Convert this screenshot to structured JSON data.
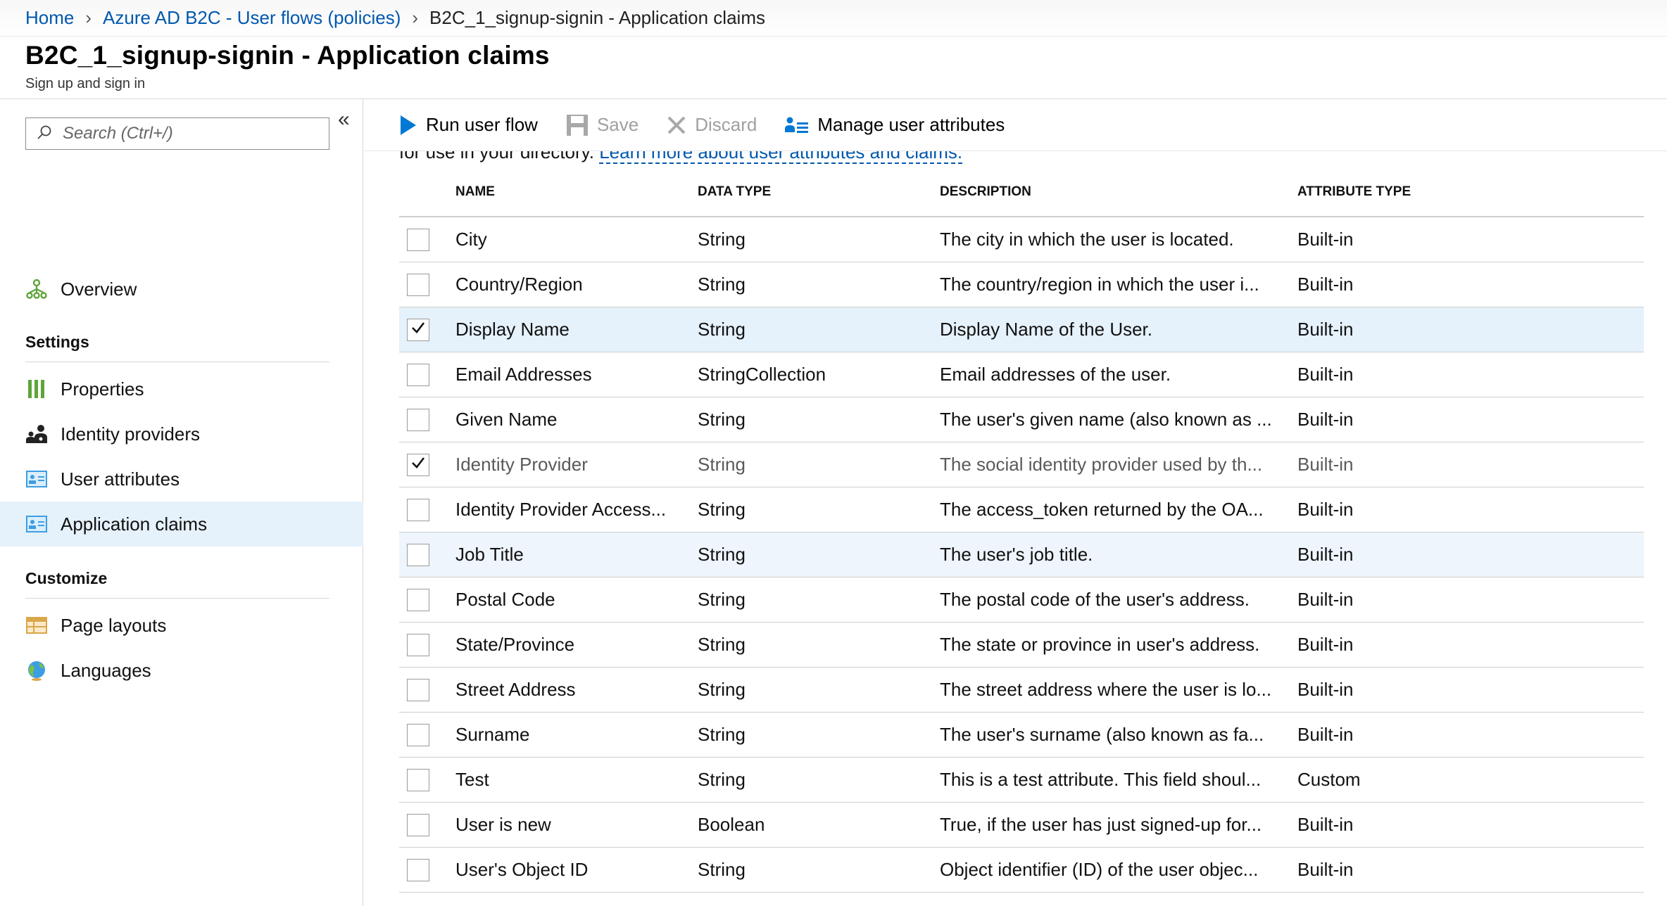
{
  "breadcrumb": {
    "home": "Home",
    "parent": "Azure AD B2C - User flows (policies)",
    "current": "B2C_1_signup-signin - Application claims"
  },
  "header": {
    "title": "B2C_1_signup-signin - Application claims",
    "subtitle": "Sign up and sign in"
  },
  "sidebar": {
    "collapse_glyph": "«",
    "search_placeholder": "Search (Ctrl+/)",
    "overview": "Overview",
    "settings_title": "Settings",
    "settings_items": [
      "Properties",
      "Identity providers",
      "User attributes",
      "Application claims"
    ],
    "customize_title": "Customize",
    "customize_items": [
      "Page layouts",
      "Languages"
    ],
    "active_item": "Application claims"
  },
  "toolbar": {
    "run": "Run user flow",
    "save": "Save",
    "discard": "Discard",
    "manage": "Manage user attributes"
  },
  "content": {
    "intro_prefix": "for use in your directory.",
    "intro_link": "Learn more about user attributes and claims."
  },
  "table": {
    "columns": [
      "NAME",
      "DATA TYPE",
      "DESCRIPTION",
      "ATTRIBUTE TYPE"
    ],
    "rows": [
      {
        "name": "City",
        "type": "String",
        "desc": "The city in which the user is located.",
        "attr": "Built-in",
        "checked": false
      },
      {
        "name": "Country/Region",
        "type": "String",
        "desc": "The country/region in which the user i...",
        "attr": "Built-in",
        "checked": false
      },
      {
        "name": "Display Name",
        "type": "String",
        "desc": "Display Name of the User.",
        "attr": "Built-in",
        "checked": true
      },
      {
        "name": "Email Addresses",
        "type": "StringCollection",
        "desc": "Email addresses of the user.",
        "attr": "Built-in",
        "checked": false
      },
      {
        "name": "Given Name",
        "type": "String",
        "desc": "The user's given name (also known as ...",
        "attr": "Built-in",
        "checked": false
      },
      {
        "name": "Identity Provider",
        "type": "String",
        "desc": "The social identity provider used by th...",
        "attr": "Built-in",
        "checked": true
      },
      {
        "name": "Identity Provider Access...",
        "type": "String",
        "desc": "The access_token returned by the OA...",
        "attr": "Built-in",
        "checked": false
      },
      {
        "name": "Job Title",
        "type": "String",
        "desc": "The user's job title.",
        "attr": "Built-in",
        "checked": false
      },
      {
        "name": "Postal Code",
        "type": "String",
        "desc": "The postal code of the user's address.",
        "attr": "Built-in",
        "checked": false
      },
      {
        "name": "State/Province",
        "type": "String",
        "desc": "The state or province in user's address.",
        "attr": "Built-in",
        "checked": false
      },
      {
        "name": "Street Address",
        "type": "String",
        "desc": "The street address where the user is lo...",
        "attr": "Built-in",
        "checked": false
      },
      {
        "name": "Surname",
        "type": "String",
        "desc": "The user's surname (also known as fa...",
        "attr": "Built-in",
        "checked": false
      },
      {
        "name": "Test",
        "type": "String",
        "desc": "This is a test attribute. This field shoul...",
        "attr": "Custom",
        "checked": false
      },
      {
        "name": "User is new",
        "type": "Boolean",
        "desc": "True, if the user has just signed-up for...",
        "attr": "Built-in",
        "checked": false
      },
      {
        "name": "User's Object ID",
        "type": "String",
        "desc": "Object identifier (ID) of the user objec...",
        "attr": "Built-in",
        "checked": false
      }
    ]
  },
  "colors": {
    "link": "#0058ad",
    "selected_row": "#e5f1fb",
    "accent_blue": "#0078d4",
    "green_icon": "#5ea43b"
  }
}
